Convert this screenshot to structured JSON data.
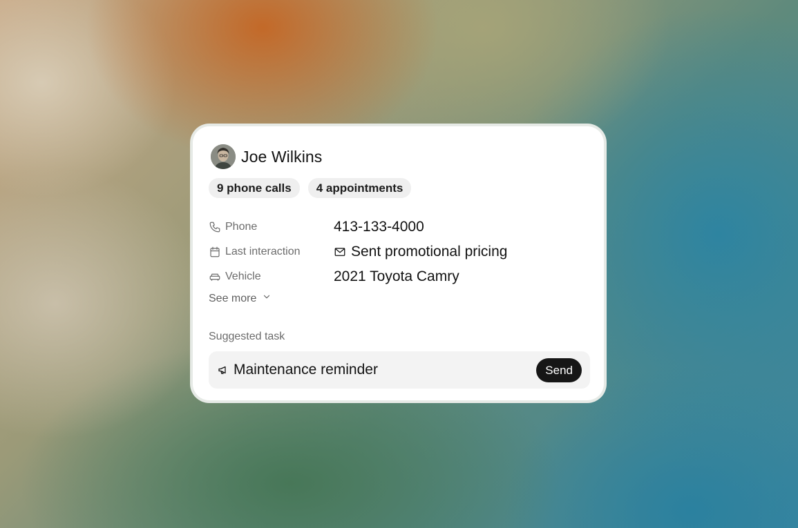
{
  "contact": {
    "name": "Joe Wilkins",
    "avatar": "avatar-photo"
  },
  "chips": [
    {
      "label": "9 phone calls"
    },
    {
      "label": "4 appointments"
    }
  ],
  "details": [
    {
      "icon": "phone-icon",
      "label": "Phone",
      "value": "413-133-4000"
    },
    {
      "icon": "calendar-icon",
      "label": "Last interaction",
      "value_icon": "mail-icon",
      "value": "Sent promotional pricing"
    },
    {
      "icon": "car-icon",
      "label": "Vehicle",
      "value": "2021 Toyota Camry"
    }
  ],
  "see_more": {
    "label": "See more",
    "icon": "chevron-down-icon"
  },
  "suggested_task": {
    "section_label": "Suggested task",
    "icon": "megaphone-icon",
    "title": "Maintenance reminder",
    "action_label": "Send"
  },
  "colors": {
    "card_bg": "#ffffff",
    "chip_bg": "#efefef",
    "task_bg": "#f3f3f3",
    "button_bg": "#161616",
    "button_text": "#ffffff",
    "muted_text": "#6b6b6b",
    "primary_text": "#111111"
  }
}
